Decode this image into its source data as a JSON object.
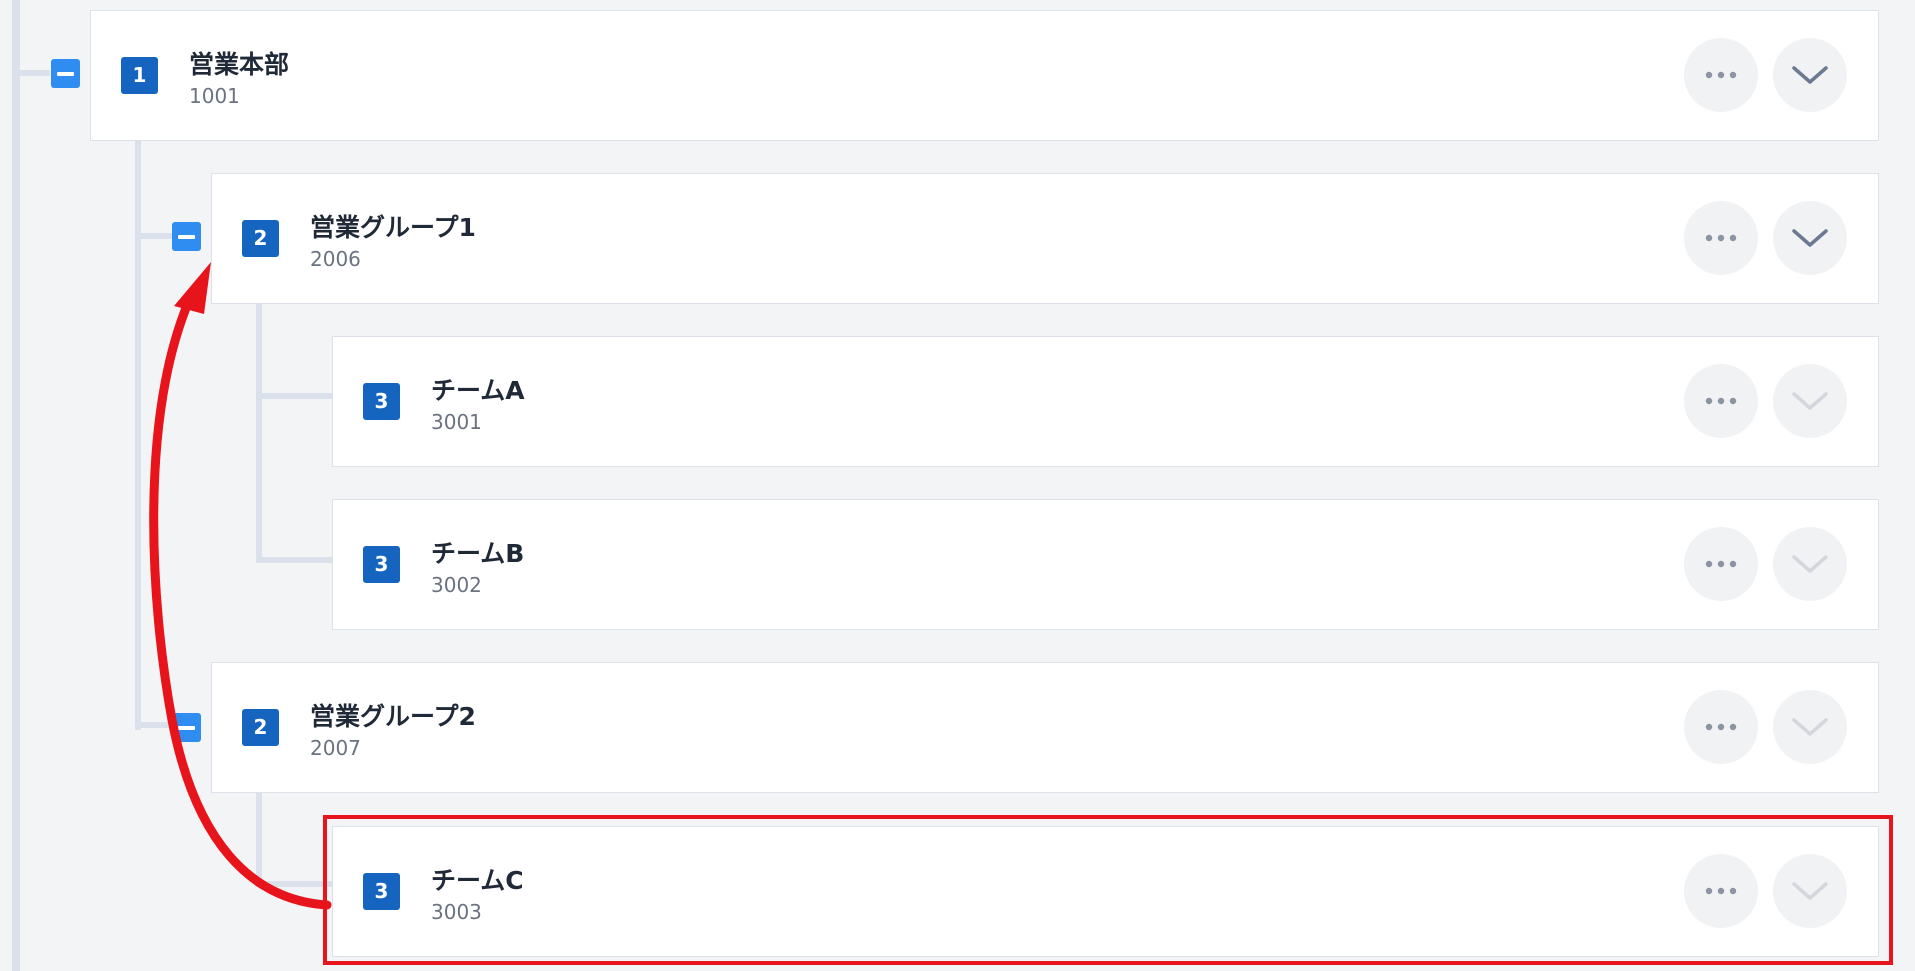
{
  "nodes": [
    {
      "level": "1",
      "name": "営業本部",
      "code": "1001",
      "collapse_control": "collapse-icon",
      "expand_state": "enabled"
    },
    {
      "level": "2",
      "name": "営業グループ1",
      "code": "2006",
      "collapse_control": "collapse-icon",
      "expand_state": "enabled"
    },
    {
      "level": "3",
      "name": "チームA",
      "code": "3001",
      "expand_state": "disabled"
    },
    {
      "level": "3",
      "name": "チームB",
      "code": "3002",
      "expand_state": "disabled"
    },
    {
      "level": "2",
      "name": "営業グループ2",
      "code": "2007",
      "collapse_control": "collapse-icon",
      "expand_state": "disabled"
    },
    {
      "level": "3",
      "name": "チームC",
      "code": "3003",
      "expand_state": "disabled",
      "highlighted": true
    }
  ],
  "icons": {
    "more": "more-horizontal-icon",
    "expand": "chevron-down-icon",
    "collapse": "minus-icon"
  },
  "colors": {
    "badge": "#1565c0",
    "collapse_button": "#2f8cf0",
    "highlight": "#e8141c",
    "arrow": "#e8141c",
    "chevron_enabled": "#6b7a90",
    "chevron_disabled": "#d3d7dd",
    "dots": "#8a94a3"
  },
  "annotation": {
    "type": "drag-move-arrow",
    "from": "チームC",
    "to": "営業グループ1"
  }
}
